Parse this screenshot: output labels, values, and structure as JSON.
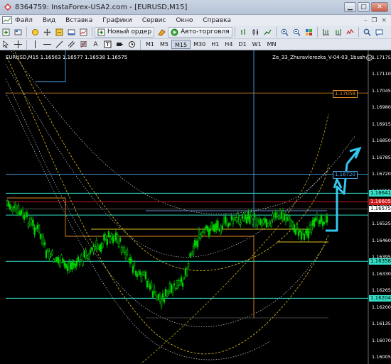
{
  "window": {
    "title": "8364759: InstaForex-USA2.com - [EURUSD,M15]"
  },
  "menu": [
    "Файл",
    "Вид",
    "Вставка",
    "Графики",
    "Сервис",
    "Окно",
    "Справка"
  ],
  "toolbar": {
    "new_order_label": "Новый ордер",
    "autotrading_label": "Авто-торговля"
  },
  "timeframes": [
    "M1",
    "M5",
    "M15",
    "M30",
    "H1",
    "H4",
    "D1",
    "W1",
    "MN"
  ],
  "active_timeframe": "M15",
  "chart": {
    "header": "EURUSD,M15  1.16563 1.16577 1.16538 1.16575",
    "indicator_name": "Ze_33_Zhuravlerezka_V-04-03_1bush",
    "price_axis": [
      "1.17175",
      "1.17110",
      "1.17045",
      "1.16980",
      "1.16915",
      "1.16850",
      "1.16785",
      "1.16720",
      "1.16655",
      "1.16590",
      "1.16525",
      "1.16460",
      "1.16395",
      "1.16330",
      "1.16265",
      "1.16200",
      "1.16135",
      "1.16070",
      "1.16005"
    ],
    "level_tags": {
      "orange_level": "1.17058",
      "blue_level": "1.16720",
      "current_price": "1.16575",
      "teal_top": "1.16641",
      "red_level": "1.16605",
      "teal_mid": "1.16358",
      "teal_bottom": "1.16204"
    },
    "colors": {
      "candles": "#00d000",
      "teal": "#33e0c8",
      "blue": "#4aa7e8",
      "orange": "#e08a20",
      "yellow": "#e0c020",
      "red": "#d01818",
      "arrow": "#35c8ee"
    }
  }
}
